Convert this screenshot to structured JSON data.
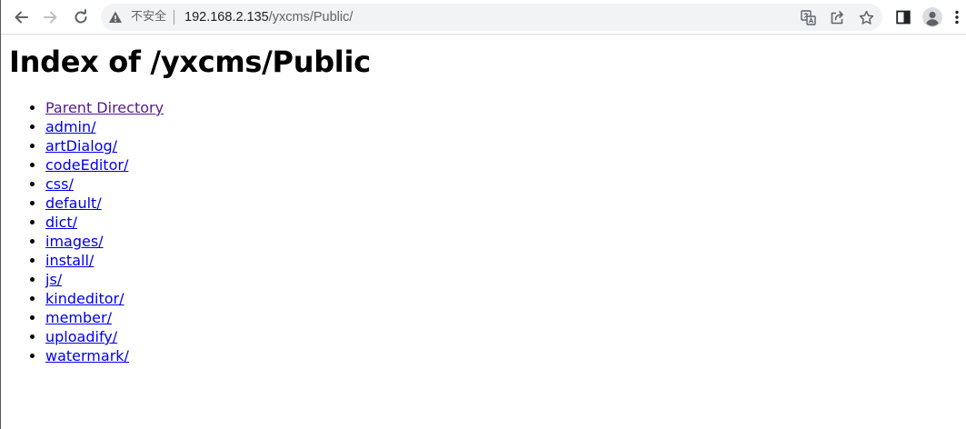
{
  "browser": {
    "omnibox": {
      "security_label": "不安全",
      "url_host": "192.168.2.135",
      "url_path": "/yxcms/Public/"
    },
    "icons": {
      "back": "back-arrow-icon",
      "forward": "forward-arrow-icon",
      "reload": "reload-icon",
      "warning": "warning-triangle-icon",
      "translate": "translate-icon",
      "share": "share-icon",
      "bookmark": "star-icon",
      "side_panel": "side-panel-icon",
      "profile": "profile-avatar-icon",
      "menu": "kebab-menu-icon"
    }
  },
  "page": {
    "title": "Index of /yxcms/Public",
    "entries": [
      {
        "label": "Parent Directory",
        "visited": true
      },
      {
        "label": "admin/"
      },
      {
        "label": "artDialog/"
      },
      {
        "label": "codeEditor/"
      },
      {
        "label": "css/"
      },
      {
        "label": "default/"
      },
      {
        "label": "dict/"
      },
      {
        "label": "images/"
      },
      {
        "label": "install/"
      },
      {
        "label": "js/"
      },
      {
        "label": "kindeditor/"
      },
      {
        "label": "member/"
      },
      {
        "label": "uploadify/"
      },
      {
        "label": "watermark/"
      }
    ]
  },
  "colors": {
    "link": "#0000ee",
    "visited_link": "#551a8b",
    "omnibox_bg": "#f1f3f4",
    "icon": "#5f6368"
  }
}
